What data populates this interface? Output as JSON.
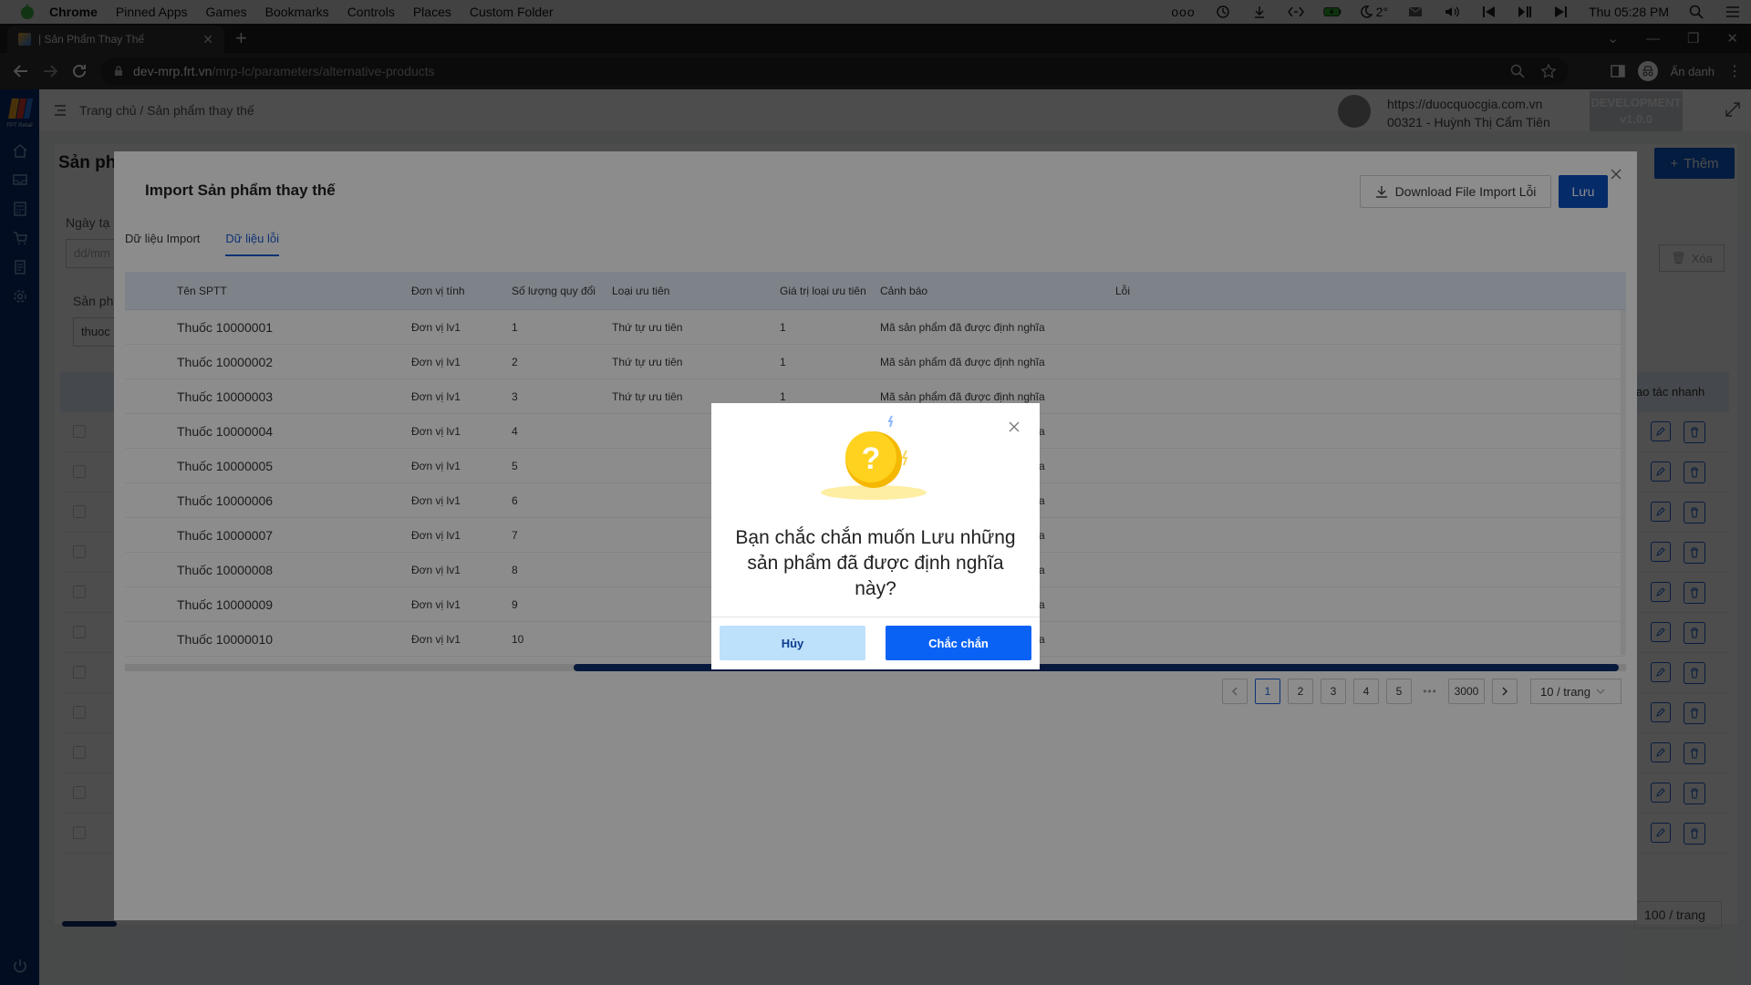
{
  "menubar": {
    "items": [
      "Chrome",
      "Pinned Apps",
      "Games",
      "Bookmarks",
      "Controls",
      "Places",
      "Custom Folder"
    ],
    "weather": "2°",
    "clock": "Thu 05:28 PM",
    "dots": "ooo"
  },
  "browser": {
    "tab_title": "| Sản Phẩm Thay Thế",
    "new_tab_symbol": "+",
    "url_host": "dev-mrp.frt.vn",
    "url_path": "/mrp-lc/parameters/alternative-products",
    "profile_label": "Ẩn danh"
  },
  "app": {
    "logo_text": "FPT Retail",
    "breadcrumb": "Trang chủ / Sản phẩm thay thế",
    "user_site": "https://duocquocgia.com.vn",
    "user_name": "00321 - Huỳnh Thị Cẩm Tiên",
    "env_line1": "DEVELOPMENT",
    "env_line2": "v1.0.0",
    "page_title": "Sản phẩ",
    "add_button": "Thêm",
    "filter_date_label": "Ngày tạ",
    "filter_date_placeholder": "dd/mm",
    "filter_product_label": "Sản ph",
    "filter_product_value": "thuoc",
    "delete_button": "Xóa",
    "quick_action_header": "ao tác nhanh",
    "page_size": "100 / trang"
  },
  "import_modal": {
    "title": "Import Sản phẩm thay thế",
    "download_button": "Download File Import Lỗi",
    "save_button": "Lưu",
    "tabs": [
      {
        "label": "Dữ liệu Import",
        "active": false
      },
      {
        "label": "Dữ liệu lỗi",
        "active": true
      }
    ],
    "columns": [
      "Tên SPTT",
      "Đơn vị tính",
      "Số lượng quy đổi",
      "Loại ưu tiên",
      "Giá trị loại ưu tiên",
      "Cảnh báo",
      "Lỗi"
    ],
    "rows": [
      [
        "Thuốc 10000001",
        "Đơn vị lv1",
        "1",
        "Thứ tự ưu tiên",
        "1",
        "Mã sản phẩm đã được định nghĩa",
        ""
      ],
      [
        "Thuốc 10000002",
        "Đơn vị lv1",
        "2",
        "Thứ tự ưu tiên",
        "1",
        "Mã sản phẩm đã được định nghĩa",
        ""
      ],
      [
        "Thuốc 10000003",
        "Đơn vị lv1",
        "3",
        "Thứ tự ưu tiên",
        "1",
        "Mã sản phẩm đã được định nghĩa",
        ""
      ],
      [
        "Thuốc 10000004",
        "Đơn vị lv1",
        "4",
        "",
        "",
        "Mã sản phẩm đã được định nghĩa",
        ""
      ],
      [
        "Thuốc 10000005",
        "Đơn vị lv1",
        "5",
        "",
        "",
        "Mã sản phẩm đã được định nghĩa",
        ""
      ],
      [
        "Thuốc 10000006",
        "Đơn vị lv1",
        "6",
        "",
        "",
        "Mã sản phẩm đã được định nghĩa",
        ""
      ],
      [
        "Thuốc 10000007",
        "Đơn vị lv1",
        "7",
        "",
        "",
        "Mã sản phẩm đã được định nghĩa",
        ""
      ],
      [
        "Thuốc 10000008",
        "Đơn vị lv1",
        "8",
        "",
        "",
        "Mã sản phẩm đã được định nghĩa",
        ""
      ],
      [
        "Thuốc 10000009",
        "Đơn vị lv1",
        "9",
        "",
        "",
        "Mã sản phẩm đã được định nghĩa",
        ""
      ],
      [
        "Thuốc 10000010",
        "Đơn vị lv1",
        "10",
        "",
        "",
        "Mã sản phẩm đã được định nghĩa",
        ""
      ]
    ],
    "pagination": {
      "pages": [
        "1",
        "2",
        "3",
        "4",
        "5"
      ],
      "current": "1",
      "ellipsis": "•••",
      "last": "3000",
      "page_size": "10 / trang"
    }
  },
  "confirm": {
    "question_mark": "?",
    "message": "Bạn chắc chắn muốn Lưu những sản phẩm đã được định nghĩa này?",
    "cancel_label": "Hủy",
    "ok_label": "Chắc chắn"
  },
  "colors": {
    "sidebar": "#0d2e6e",
    "primary": "#0a62f5",
    "cancel_bg": "#bde0fb",
    "table_header": "#e6eefb"
  }
}
